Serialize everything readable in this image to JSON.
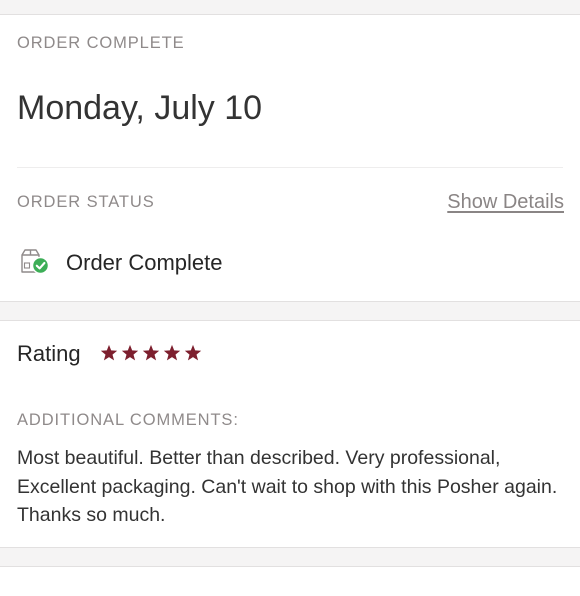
{
  "order": {
    "complete_heading": "ORDER COMPLETE",
    "date": "Monday, July 10",
    "status_heading": "ORDER STATUS",
    "show_details_label": "Show Details",
    "status_icon": "package-check-icon",
    "status_text": "Order Complete"
  },
  "rating": {
    "label": "Rating",
    "stars": 5,
    "max_stars": 5,
    "star_color": "#7d1f2e",
    "comments_heading": "ADDITIONAL COMMENTS:",
    "comment": "Most beautiful. Better than described. Very professional, Excellent packaging. Can't wait to shop with this Posher again. Thanks so much."
  },
  "colors": {
    "page_background": "#f5f4f4",
    "card_background": "#ffffff",
    "muted_text": "#8f8a8a",
    "status_check": "#3dae57"
  }
}
